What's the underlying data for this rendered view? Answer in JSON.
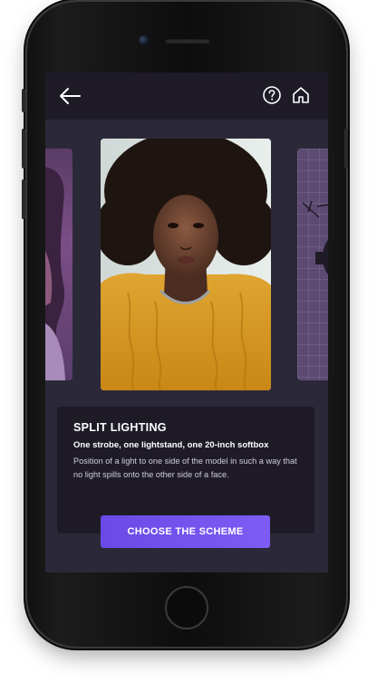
{
  "header": {
    "back_icon": "arrow-left-icon",
    "help_icon": "question-circle-icon",
    "home_icon": "home-icon"
  },
  "carousel": {
    "current_image": "portrait of woman with afro in yellow knit sweater",
    "prev_image": "portrait in purple tones",
    "next_image": "lighting diagram on grid"
  },
  "scheme": {
    "title": "SPLIT LIGHTING",
    "subtitle": "One strobe, one lightstand, one 20-inch softbox",
    "description": "Position of a light to one side of the model in such a way that no light spills onto the other side of a face."
  },
  "cta": {
    "label": "CHOOSE THE SCHEME"
  },
  "colors": {
    "background": "#2b2838",
    "panel": "#1e1b27",
    "accent": "#7556ef",
    "text": "#ffffff"
  }
}
